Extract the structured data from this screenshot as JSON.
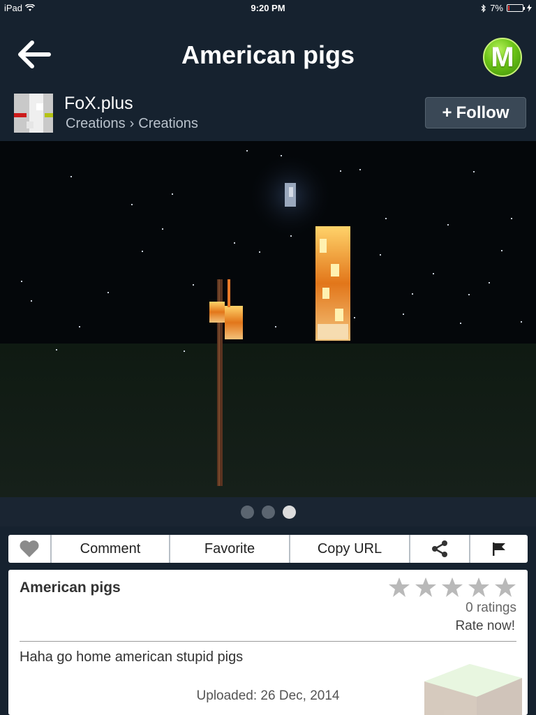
{
  "status_bar": {
    "device": "iPad",
    "time": "9:20 PM",
    "battery": "7%",
    "battery_level": 0.07
  },
  "nav": {
    "title": "American pigs",
    "back_icon": "back-arrow-icon",
    "logo_letter": "M"
  },
  "author": {
    "name": "FoX.plus",
    "breadcrumb": [
      "Creations",
      "›",
      "Creations"
    ],
    "follow_label": "Follow",
    "follow_icon": "+"
  },
  "gallery": {
    "pages": 3,
    "current_page": 3
  },
  "actions": {
    "like_icon": "heart-icon",
    "comment": "Comment",
    "favorite": "Favorite",
    "copy_url": "Copy URL",
    "share_icon": "share-icon",
    "flag_icon": "flag-icon"
  },
  "detail": {
    "title": "American pigs",
    "stars": 5,
    "rating_value": 0,
    "ratings_count": "0 ratings",
    "rate_now": "Rate now!",
    "description": "Haha go home american stupid pigs",
    "uploaded": "Uploaded: 26 Dec, 2014"
  },
  "colors": {
    "background": "#16222f",
    "logo_green": "#6cc417",
    "active_dot": "#dcdcdc",
    "inactive_dot": "#5b6570"
  }
}
